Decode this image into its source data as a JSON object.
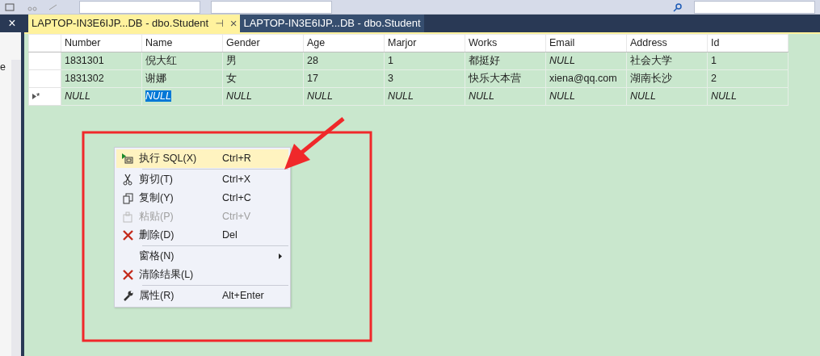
{
  "left_panel": {
    "close": "×",
    "text": "e"
  },
  "tabs": [
    {
      "label": "LAPTOP-IN3E6IJP...DB - dbo.Student",
      "selected": true,
      "pin": "⊣",
      "close": "×"
    },
    {
      "label": "LAPTOP-IN3E6IJP...DB - dbo.Student",
      "selected": false
    }
  ],
  "grid": {
    "columns": [
      "Number",
      "Name",
      "Gender",
      "Age",
      "Marjor",
      "Works",
      "Email",
      "Address",
      "Id"
    ],
    "rows": [
      {
        "new_row": false,
        "cells": [
          {
            "text": "1831301",
            "kind": "value",
            "selected": false
          },
          {
            "text": "倪大红",
            "kind": "value",
            "selected": false
          },
          {
            "text": "男",
            "kind": "value",
            "selected": false
          },
          {
            "text": "28",
            "kind": "value",
            "selected": false
          },
          {
            "text": "1",
            "kind": "value",
            "selected": false
          },
          {
            "text": "都挺好",
            "kind": "value",
            "selected": false
          },
          {
            "text": "NULL",
            "kind": "null",
            "selected": false
          },
          {
            "text": "社会大学",
            "kind": "value",
            "selected": false
          },
          {
            "text": "1",
            "kind": "value",
            "selected": false
          }
        ]
      },
      {
        "new_row": false,
        "cells": [
          {
            "text": "1831302",
            "kind": "value",
            "selected": false
          },
          {
            "text": "谢娜",
            "kind": "value",
            "selected": false
          },
          {
            "text": "女",
            "kind": "value",
            "selected": false
          },
          {
            "text": "17",
            "kind": "value",
            "selected": false
          },
          {
            "text": "3",
            "kind": "value",
            "selected": false
          },
          {
            "text": "快乐大本营",
            "kind": "value",
            "selected": false
          },
          {
            "text": "xiena@qq.com",
            "kind": "value",
            "selected": false
          },
          {
            "text": "湖南长沙",
            "kind": "value",
            "selected": false
          },
          {
            "text": "2",
            "kind": "value",
            "selected": false
          }
        ]
      },
      {
        "new_row": true,
        "marker": "*",
        "cells": [
          {
            "text": "NULL",
            "kind": "null",
            "selected": false
          },
          {
            "text": "NULL",
            "kind": "null",
            "selected": true
          },
          {
            "text": "NULL",
            "kind": "null",
            "selected": false
          },
          {
            "text": "NULL",
            "kind": "null",
            "selected": false
          },
          {
            "text": "NULL",
            "kind": "null",
            "selected": false
          },
          {
            "text": "NULL",
            "kind": "null",
            "selected": false
          },
          {
            "text": "NULL",
            "kind": "null",
            "selected": false
          },
          {
            "text": "NULL",
            "kind": "null",
            "selected": false
          },
          {
            "text": "NULL",
            "kind": "null",
            "selected": false
          }
        ]
      }
    ]
  },
  "context_menu": [
    {
      "kind": "execute",
      "label": "执行 SQL(X)",
      "shortcut": "Ctrl+R",
      "selected": true,
      "disabled": false
    },
    {
      "kind": "separator"
    },
    {
      "kind": "cut",
      "label": "剪切(T)",
      "shortcut": "Ctrl+X",
      "selected": false,
      "disabled": false
    },
    {
      "kind": "copy",
      "label": "复制(Y)",
      "shortcut": "Ctrl+C",
      "selected": false,
      "disabled": false
    },
    {
      "kind": "paste",
      "label": "粘贴(P)",
      "shortcut": "Ctrl+V",
      "selected": false,
      "disabled": true
    },
    {
      "kind": "delete",
      "label": "删除(D)",
      "shortcut": "Del",
      "selected": false,
      "disabled": false
    },
    {
      "kind": "separator"
    },
    {
      "kind": "submenu",
      "label": "窗格(N)",
      "selected": false,
      "disabled": false
    },
    {
      "kind": "delete",
      "label": "清除结果(L)",
      "selected": false,
      "disabled": false
    },
    {
      "kind": "separator"
    },
    {
      "kind": "properties",
      "label": "属性(R)",
      "shortcut": "Alt+Enter",
      "selected": false,
      "disabled": false
    }
  ],
  "annotation": {
    "kind": "box-and-arrow"
  }
}
